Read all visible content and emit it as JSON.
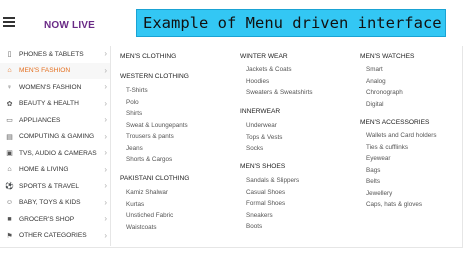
{
  "header": {
    "brand": "NOW LIVE",
    "banner": "Example of Menu driven interface"
  },
  "sidebar": {
    "items": [
      {
        "label": "PHONES & TABLETS",
        "icon": "phone-icon"
      },
      {
        "label": "MEN'S FASHION",
        "icon": "shirt-icon",
        "active": true
      },
      {
        "label": "WOMEN'S FASHION",
        "icon": "dress-icon"
      },
      {
        "label": "BEAUTY & HEALTH",
        "icon": "beauty-icon"
      },
      {
        "label": "APPLIANCES",
        "icon": "appliance-icon"
      },
      {
        "label": "COMPUTING & GAMING",
        "icon": "computer-icon"
      },
      {
        "label": "TVS, AUDIO & CAMERAS",
        "icon": "tv-icon"
      },
      {
        "label": "HOME & LIVING",
        "icon": "home-icon"
      },
      {
        "label": "SPORTS & TRAVEL",
        "icon": "sports-icon"
      },
      {
        "label": "BABY, TOYS & KIDS",
        "icon": "baby-icon"
      },
      {
        "label": "GROCER'S SHOP",
        "icon": "cart-icon"
      },
      {
        "label": "OTHER CATEGORIES",
        "icon": "flag-icon"
      }
    ],
    "chevron": "›"
  },
  "menu": {
    "col1": {
      "mens_clothing": "MEN'S CLOTHING",
      "western": {
        "title": "WESTERN CLOTHING",
        "items": [
          "T-Shirts",
          "Polo",
          "Shirts",
          "Sweat & Loungepants",
          "Trousers & pants",
          "Jeans",
          "Shorts & Cargos"
        ]
      },
      "pakistani": {
        "title": "PAKISTANI CLOTHING",
        "items": [
          "Kamiz Shalwar",
          "Kurtas",
          "Unstiched Fabric",
          "Waistcoats"
        ]
      }
    },
    "col2": {
      "winter": {
        "title": "WINTER WEAR",
        "items": [
          "Jackets & Coats",
          "Hoodies",
          "Sweaters & Sweatshirts"
        ]
      },
      "innerwear": {
        "title": "INNERWEAR",
        "items": [
          "Underwear",
          "Tops & Vests",
          "Socks"
        ]
      },
      "shoes": {
        "title": "MEN'S SHOES",
        "items": [
          "Sandals & Slippers",
          "Casual Shoes",
          "Formal Shoes",
          "Sneakers",
          "Boots"
        ]
      }
    },
    "col3": {
      "watches": {
        "title": "MEN'S WATCHES",
        "items": [
          "Smart",
          "Analog",
          "Chronograph",
          "Digital"
        ]
      },
      "accessories": {
        "title": "MEN'S ACCESSORIES",
        "items": [
          "Wallets and Card holders",
          "Ties & cufflinks",
          "Eyewear",
          "Bags",
          "Belts",
          "Jewellery",
          "Caps, hats & gloves"
        ]
      }
    }
  }
}
